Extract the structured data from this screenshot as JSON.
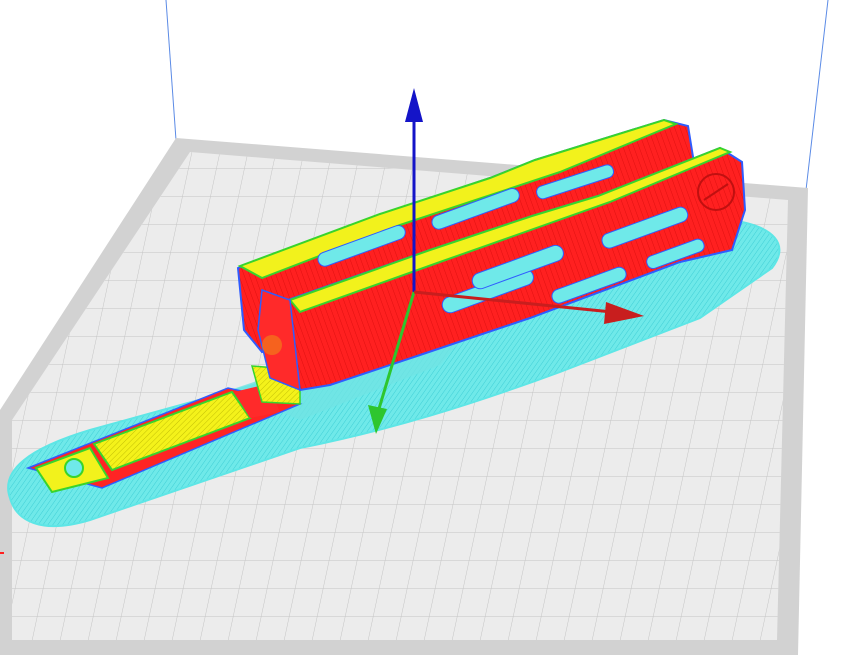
{
  "viewport": {
    "colors": {
      "background": "#ffffff",
      "build_volume_line": "#5b8be6",
      "plate_border": "#cdcdcd",
      "plate_surface": "#ececec",
      "grid_line": "#c7c7c7",
      "skirt": "#5ee6e6",
      "wall_outer": "#ff1f1f",
      "wall_inner": "#38d42c",
      "skin": "#f2f21c",
      "outline": "#2f5cff",
      "axis_z": "#1414c8",
      "axis_y": "#2ec62e",
      "axis_x": "#c81e1e"
    },
    "axes": {
      "x": {
        "name": "x-axis-arrow"
      },
      "y": {
        "name": "y-axis-arrow"
      },
      "z": {
        "name": "z-axis-arrow"
      }
    },
    "model": {
      "name": "sliced-handguard-model"
    }
  }
}
